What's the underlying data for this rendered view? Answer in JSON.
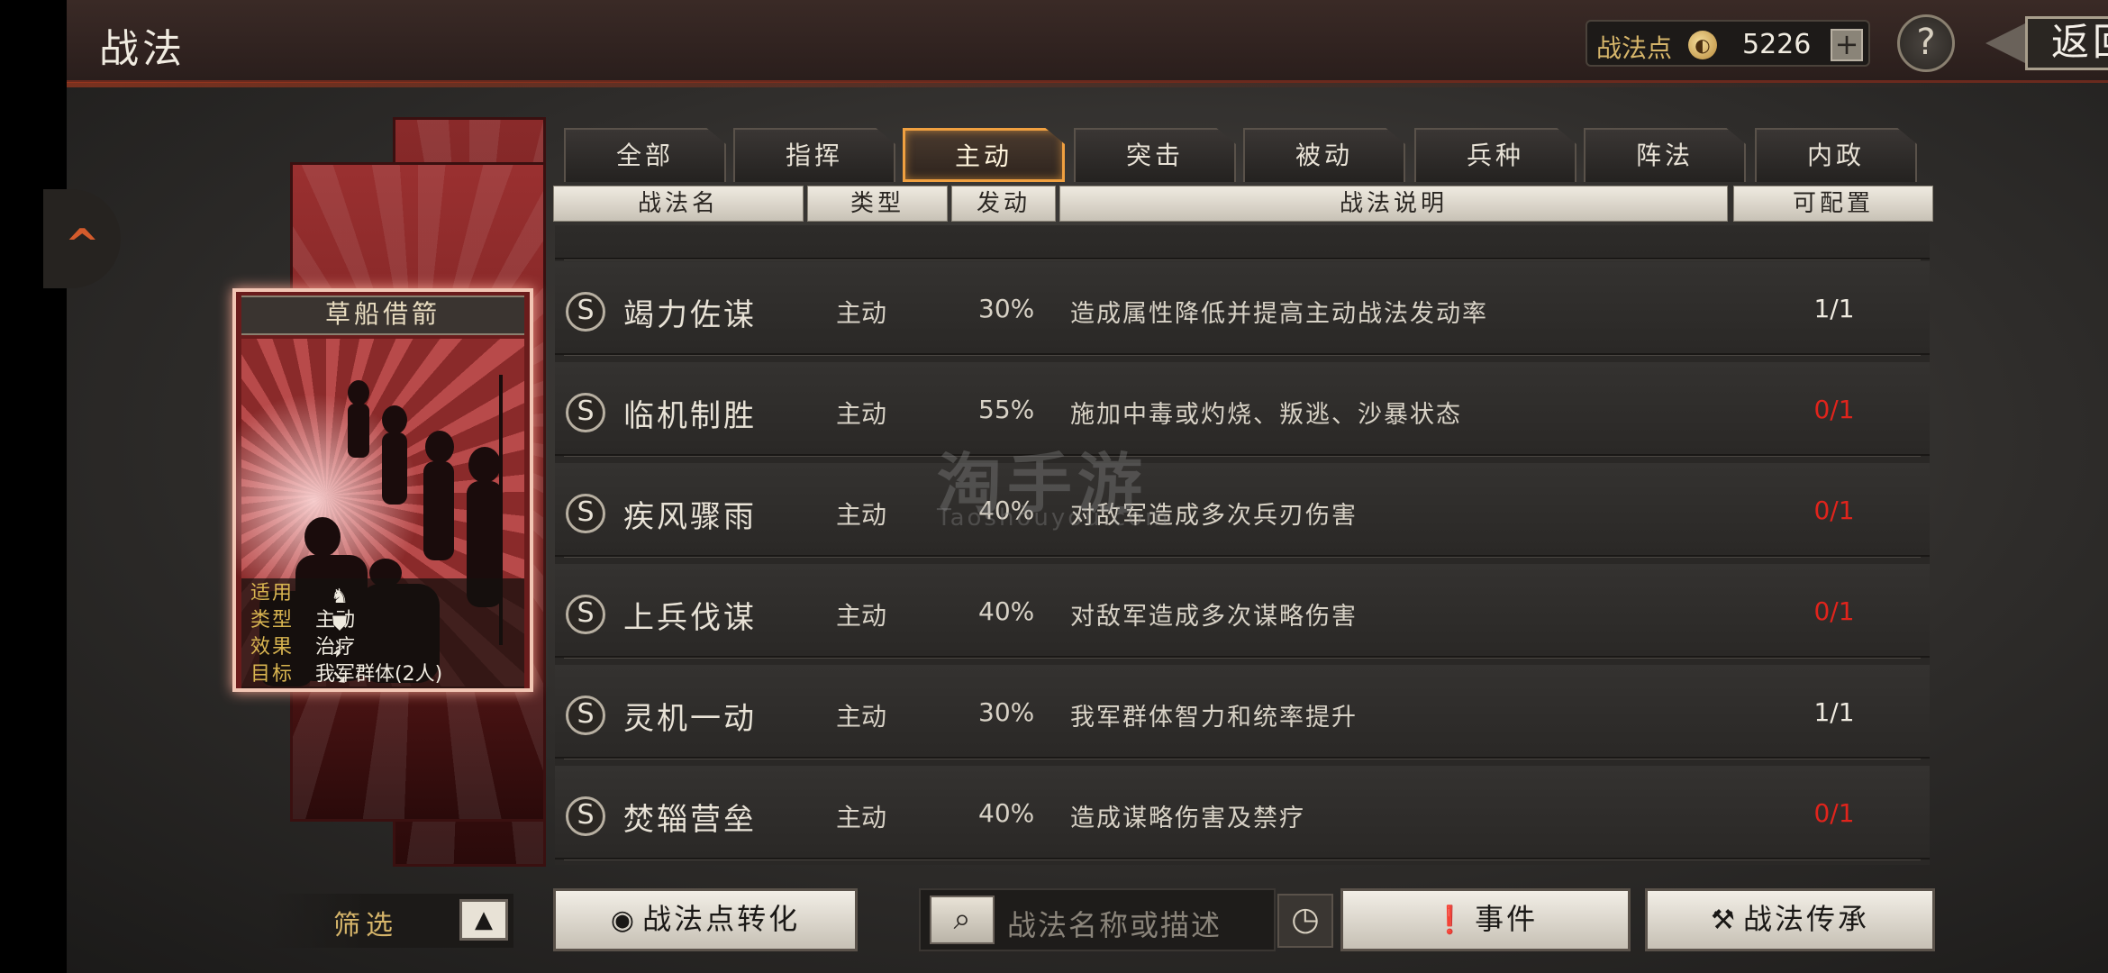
{
  "header": {
    "title": "战法",
    "points_label": "战法点",
    "points_value": "5226",
    "plus": "+",
    "help": "?",
    "back": "返回"
  },
  "tabs": [
    {
      "label": "全部",
      "active": false
    },
    {
      "label": "指挥",
      "active": false
    },
    {
      "label": "主动",
      "active": true
    },
    {
      "label": "突击",
      "active": false
    },
    {
      "label": "被动",
      "active": false
    },
    {
      "label": "兵种",
      "active": false
    },
    {
      "label": "阵法",
      "active": false
    },
    {
      "label": "内政",
      "active": false
    }
  ],
  "columns": {
    "name": "战法名",
    "type": "类型",
    "rate": "发动",
    "desc": "战法说明",
    "config": "可配置"
  },
  "card": {
    "name": "草船借箭",
    "applies_label": "适用",
    "type_label": "类型",
    "type_value": "主动",
    "effect_label": "效果",
    "effect_value": "治疗",
    "target_label": "目标",
    "target_value": "我军群体(2人)",
    "troop_icons": [
      "cavalry-icon",
      "shield-icon",
      "bow-icon",
      "spear-icon",
      "wheel-icon"
    ]
  },
  "rows": [
    {
      "grade": "S",
      "name": "竭力佐谋",
      "type": "主动",
      "rate": "30%",
      "desc": "造成属性降低并提高主动战法发动率",
      "config": "1/1",
      "available": true
    },
    {
      "grade": "S",
      "name": "临机制胜",
      "type": "主动",
      "rate": "55%",
      "desc": "施加中毒或灼烧、叛逃、沙暴状态",
      "config": "0/1",
      "available": false
    },
    {
      "grade": "S",
      "name": "疾风骤雨",
      "type": "主动",
      "rate": "40%",
      "desc": "对敌军造成多次兵刃伤害",
      "config": "0/1",
      "available": false
    },
    {
      "grade": "S",
      "name": "上兵伐谋",
      "type": "主动",
      "rate": "40%",
      "desc": "对敌军造成多次谋略伤害",
      "config": "0/1",
      "available": false
    },
    {
      "grade": "S",
      "name": "灵机一动",
      "type": "主动",
      "rate": "30%",
      "desc": "我军群体智力和统率提升",
      "config": "1/1",
      "available": true
    },
    {
      "grade": "S",
      "name": "焚辎营垒",
      "type": "主动",
      "rate": "40%",
      "desc": "造成谋略伤害及禁疗",
      "config": "0/1",
      "available": false
    }
  ],
  "filter": {
    "label": "筛选"
  },
  "bottom": {
    "convert": "战法点转化",
    "search_placeholder": "战法名称或描述",
    "events": "事件",
    "inherit": "战法传承"
  },
  "watermark": {
    "main": "淘手游",
    "sub": "Taoshouyou.com"
  },
  "colors": {
    "accent": "#f0a040",
    "unavailable": "#e0241c",
    "gold_label": "#d6b56a"
  }
}
